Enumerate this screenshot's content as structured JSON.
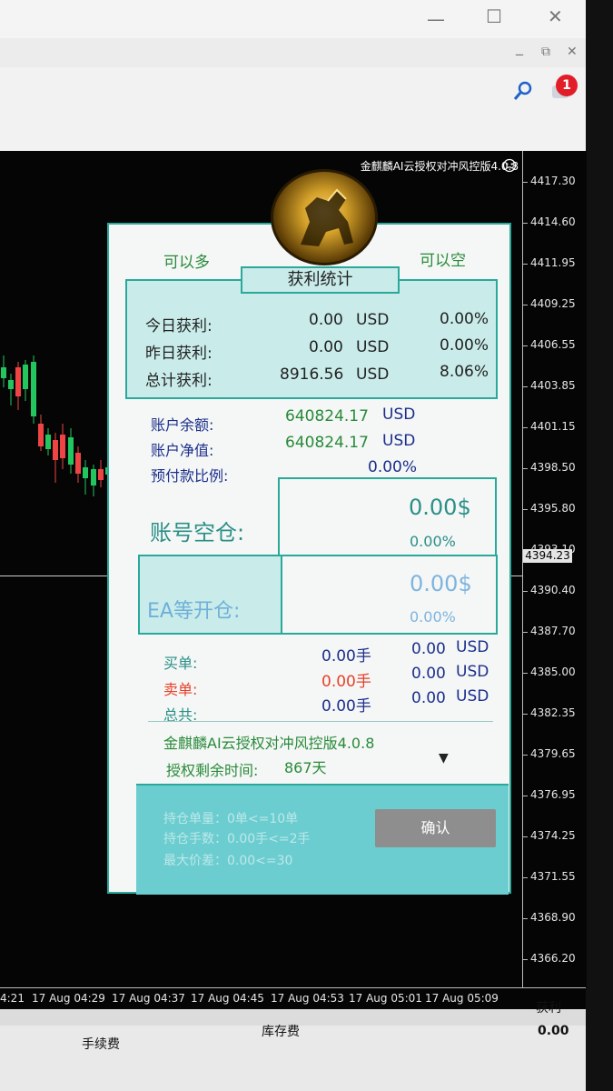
{
  "window": {
    "minimize": "—",
    "maximize": "☐",
    "close": "✕",
    "sub_minimize": "_",
    "sub_restore": "⧉",
    "sub_close": "✕",
    "notification_count": "1"
  },
  "chart": {
    "ea_title": "金麒麟AI云授权对冲风控版4.0.8",
    "price_ticks": [
      "4417.30",
      "4414.60",
      "4411.95",
      "4409.25",
      "4406.55",
      "4403.85",
      "4401.15",
      "4398.50",
      "4395.80",
      "4393.10",
      "4390.40",
      "4387.70",
      "4385.00",
      "4382.35",
      "4379.65",
      "4376.95",
      "4374.25",
      "4371.55",
      "4368.90",
      "4366.20"
    ],
    "current_price": "4394.23",
    "time_labels": [
      "4:21",
      "17 Aug 04:29",
      "17 Aug 04:37",
      "17 Aug 04:45",
      "17 Aug 04:53",
      "17 Aug 05:01",
      "17 Aug 05:09"
    ]
  },
  "terminal": {
    "col_fee": "手续费",
    "col_swap": "库存费",
    "col_profit": "获利",
    "profit_value": "0.00"
  },
  "panel": {
    "can_long": "可以多",
    "can_short": "可以空",
    "stats_title": "获利统计",
    "stats": [
      {
        "label": "今日获利:",
        "amount": "0.00",
        "currency": "USD",
        "pct": "0.00%"
      },
      {
        "label": "昨日获利:",
        "amount": "0.00",
        "currency": "USD",
        "pct": "0.00%"
      },
      {
        "label": "总计获利:",
        "amount": "8916.56",
        "currency": "USD",
        "pct": "8.06%"
      }
    ],
    "balance_label": "账户余额:",
    "balance_value": "640824.17",
    "balance_currency": "USD",
    "equity_label": "账户净值:",
    "equity_value": "640824.17",
    "equity_currency": "USD",
    "prepay_label": "预付款比例:",
    "prepay_value": "0.00%",
    "flat_label": "账号空仓:",
    "flat_amount": "0.00$",
    "flat_pct": "0.00%",
    "ea_open_label": "EA等开仓:",
    "ea_open_amount": "0.00$",
    "ea_open_pct": "0.00%",
    "orders": [
      {
        "label": "买单:",
        "lots": "0.00手",
        "amount": "0.00",
        "currency": "USD"
      },
      {
        "label": "卖单:",
        "lots": "0.00手",
        "amount": "0.00",
        "currency": "USD"
      },
      {
        "label": "总共:",
        "lots": "0.00手",
        "amount": "0.00",
        "currency": "USD"
      }
    ],
    "product_name": "金麒麟AI云授权对冲风控版4.0.8",
    "license_label": "授权剩余时间:",
    "license_days": "867天",
    "dropdown_arrow": "▼",
    "limits": [
      "持仓单量：0单<=10单",
      "持仓手数：0.00手<=2手",
      "最大价差：0.00<=30"
    ],
    "confirm_label": "确认"
  },
  "colors": {
    "panel_border": "#2aa89a",
    "panel_fill": "#c9ecea",
    "bull_candle": "#22c55e",
    "bear_candle": "#ef4444"
  }
}
